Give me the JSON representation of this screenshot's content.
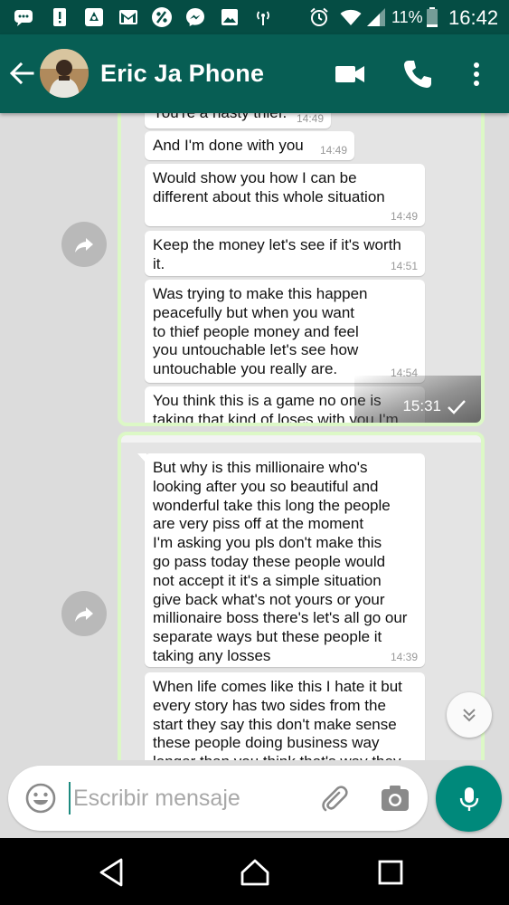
{
  "status_bar": {
    "battery": "11%",
    "time": "16:42",
    "icons": [
      "messages-icon",
      "alert-icon",
      "app-icon",
      "gmail-icon",
      "percent-icon",
      "messenger-icon",
      "gallery-icon",
      "hotspot-icon",
      "alarm-icon",
      "wifi-icon",
      "signal-icon",
      "battery-icon"
    ]
  },
  "header": {
    "contact_name": "Eric Ja Phone",
    "actions": [
      "back-arrow-icon",
      "video-call-icon",
      "phone-icon",
      "more-vert-icon"
    ]
  },
  "conversation": {
    "screenshot_1": {
      "bubbles": [
        {
          "text": "You're a nasty thief.",
          "time": "14:49"
        },
        {
          "text": "And I'm done with you",
          "time": "14:49"
        },
        {
          "text": "Would show you how I can be\ndifferent about this whole situation",
          "time": "14:49"
        },
        {
          "text": "Keep the money let's see if it's worth\nit.",
          "time": "14:51"
        },
        {
          "text": "Was trying to make this happen\npeacefully but when you want\nto thief people money and feel\nyou untouchable let's see how\nuntouchable you really are.",
          "time": "14:54"
        },
        {
          "text": "You think this is a game no one is\ntaking that kind of loses with you I'm",
          "time": ""
        }
      ],
      "sent_time": "15:31"
    },
    "screenshot_2": {
      "bubbles": [
        {
          "text": "But why is this millionaire who's\nlooking after you so beautiful and\nwonderful take this long the people\nare very piss off at the moment\nI'm asking you pls don't make this\ngo pass today these people would\nnot accept it it's a simple situation\ngive back what's not yours or your\nmillionaire boss there's let's all go our\nseparate ways but these people it\ntaking any losses",
          "time": "14:39"
        },
        {
          "text": "When life comes like this I hate it but\nevery story has two sides from the\nstart they say this don't make sense\nthese people doing business way\nlonger than you think that's way they",
          "time": ""
        }
      ]
    }
  },
  "composer": {
    "placeholder": "Escribir mensaje"
  },
  "colors": {
    "header": "#075e54",
    "status_bar": "#054d44",
    "accent": "#00897b",
    "sent_border": "#dcf8c6",
    "chat_bg": "#dcdcdc"
  }
}
